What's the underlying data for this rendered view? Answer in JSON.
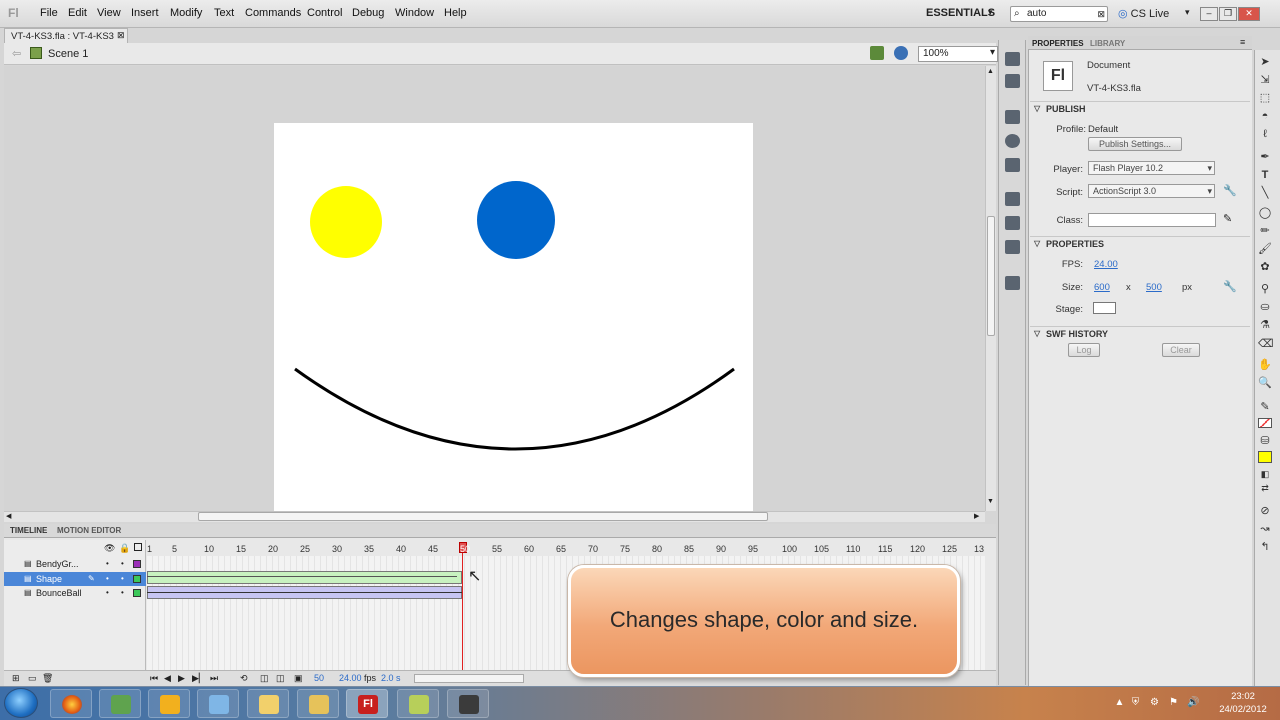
{
  "menubar": {
    "items": [
      "File",
      "Edit",
      "View",
      "Insert",
      "Modify",
      "Text",
      "Commands",
      "Control",
      "Debug",
      "Window",
      "Help"
    ],
    "workspace": "ESSENTIALS",
    "search_value": "auto",
    "cslive": "CS Live"
  },
  "document": {
    "tab_label": "VT-4-KS3.fla : VT-4-KS3",
    "scene": "Scene 1",
    "zoom": "100%"
  },
  "stage": {
    "yellow_circle_color": "#ffff00",
    "blue_circle_color": "#0066cc",
    "curve_color": "#000000"
  },
  "timeline": {
    "tabs": [
      "TIMELINE",
      "MOTION EDITOR"
    ],
    "ruler": [
      "1",
      "5",
      "10",
      "15",
      "20",
      "25",
      "30",
      "35",
      "40",
      "45",
      "50",
      "55",
      "60",
      "65",
      "70",
      "75",
      "80",
      "85",
      "90",
      "95",
      "100",
      "105",
      "110",
      "115",
      "120",
      "125",
      "13"
    ],
    "layers": [
      {
        "name": "BendyGr...",
        "color": "#9b30b8"
      },
      {
        "name": "Shape",
        "color": "#3cc85a"
      },
      {
        "name": "BounceBall",
        "color": "#3cc85a"
      }
    ],
    "current_frame": "50",
    "fps": "24.00",
    "fps_unit": "fps",
    "time": "2.0 s"
  },
  "callout": {
    "text": "Changes shape, color and size."
  },
  "properties": {
    "tabs": [
      "PROPERTIES",
      "LIBRARY"
    ],
    "doc_type": "Document",
    "doc_name": "VT-4-KS3.fla",
    "fl_badge": "Fl",
    "publish_header": "PUBLISH",
    "profile_label": "Profile:",
    "profile_value": "Default",
    "publish_settings_btn": "Publish Settings...",
    "player_label": "Player:",
    "player_value": "Flash Player 10.2",
    "script_label": "Script:",
    "script_value": "ActionScript 3.0",
    "class_label": "Class:",
    "class_value": "",
    "properties_header": "PROPERTIES",
    "fps_label": "FPS:",
    "fps_value": "24.00",
    "size_label": "Size:",
    "width": "600",
    "x": "x",
    "height": "500",
    "px": "px",
    "stage_label": "Stage:",
    "stage_color": "#ffffff",
    "swf_header": "SWF HISTORY",
    "log_btn": "Log",
    "clear_btn": "Clear"
  },
  "tools": {
    "fill_color": "#ffff00",
    "stroke_color": "#ff4444"
  },
  "taskbar": {
    "time": "23:02",
    "date": "24/02/2012"
  }
}
